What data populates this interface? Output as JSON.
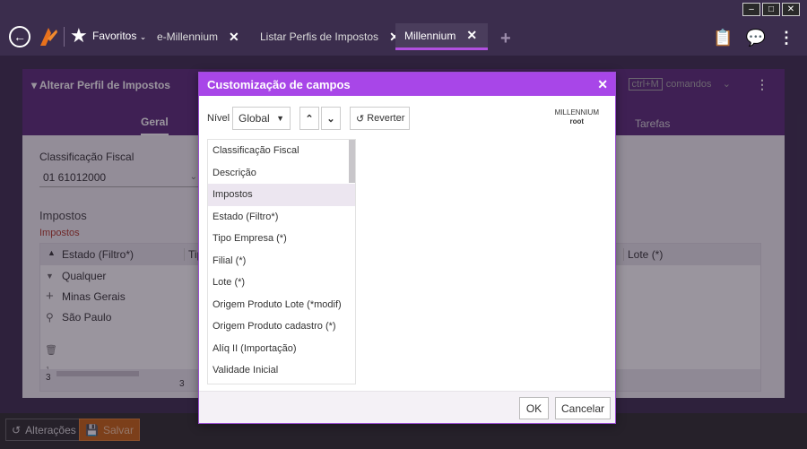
{
  "window": {
    "controls": [
      "‒",
      "□",
      "✕"
    ]
  },
  "topbar": {
    "favorites_label": "Favoritos",
    "tabs": [
      {
        "label": "e-Millennium"
      },
      {
        "label": "Listar Perfis de Impostos"
      },
      {
        "label": "Millennium"
      }
    ]
  },
  "panel": {
    "title": "Alterar Perfil de Impostos",
    "tabs": [
      "Geral",
      "Tarefas"
    ],
    "command_shortcut": "ctrl+M",
    "command_label": "comandos",
    "field_label": "Classificação Fiscal",
    "field_value": "01 61012000",
    "section_title": "Impostos",
    "section_sub": "Impostos",
    "grid": {
      "columns": [
        "Estado (Filtro*)",
        "Tip",
        "Lote (*)"
      ],
      "rows": [
        "Qualquer",
        "Minas Gerais",
        "São Paulo"
      ],
      "footer_left": "3",
      "footer_mid": "3",
      "side_number": "1"
    }
  },
  "bottom": {
    "alteracoes_label": "Alterações",
    "salvar_label": "Salvar"
  },
  "modal": {
    "title": "Customização de campos",
    "nivel_label": "Nível",
    "nivel_value": "Global",
    "revert_label": "Reverter",
    "user_line1": "MILLENNIUM",
    "user_line2": "root",
    "fields": [
      "Classificação Fiscal",
      "Descrição",
      "Impostos",
      "Estado (Filtro*)",
      "Tipo Empresa (*)",
      "Filial (*)",
      "Lote (*)",
      "Origem Produto Lote (*modif)",
      "Origem Produto cadastro (*)",
      "Alíq II (Importação)",
      "Validade Inicial"
    ],
    "selected_index": 2,
    "ok_label": "OK",
    "cancel_label": "Cancelar"
  },
  "colors": {
    "accent": "#a846e8",
    "panel_header": "#5a2a78",
    "save_button": "#c9630f"
  }
}
